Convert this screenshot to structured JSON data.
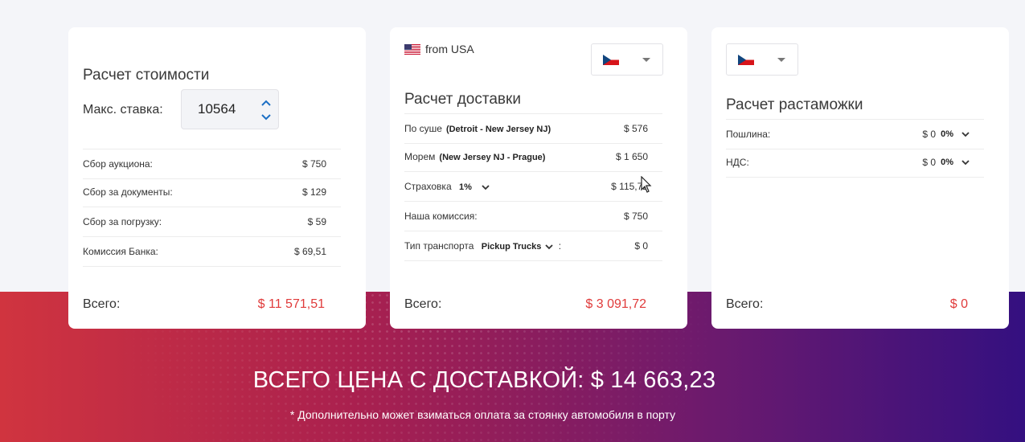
{
  "cost": {
    "title": "Расчет стоимости",
    "bid_label": "Макс. ставка:",
    "bid_value": "10564",
    "rows": [
      {
        "label": "Сбор аукциона:",
        "value": "$ 750"
      },
      {
        "label": "Сбор за документы:",
        "value": "$ 129"
      },
      {
        "label": "Сбор за погрузку:",
        "value": "$ 59"
      },
      {
        "label": "Комиссия Банка:",
        "value": "$ 69,51"
      }
    ],
    "total_label": "Всего:",
    "total_value": "$ 11 571,51"
  },
  "delivery": {
    "from_label": "from USA",
    "title": "Расчет доставки",
    "land_label": "По суше",
    "land_route": "(Detroit - New Jersey NJ)",
    "land_value": "$ 576",
    "sea_label": "Морем",
    "sea_route": "(New Jersey NJ - Prague)",
    "sea_value": "$ 1 650",
    "insurance_label": "Страховка",
    "insurance_option": "1%",
    "insurance_value": "$ 115,72",
    "commission_label": "Наша комиссия:",
    "commission_value": "$ 750",
    "transport_label": "Тип транспорта",
    "transport_option": "Pickup Trucks",
    "transport_suffix": ":",
    "transport_value": "$ 0",
    "total_label": "Всего:",
    "total_value": "$ 3 091,72"
  },
  "customs": {
    "title": "Расчет растаможки",
    "duty_label": "Пошлина:",
    "duty_value": "$ 0",
    "duty_pct": "0%",
    "vat_label": "НДС:",
    "vat_value": "$ 0",
    "vat_pct": "0%",
    "total_label": "Всего:",
    "total_value": "$ 0"
  },
  "summary": {
    "grand_total": "ВСЕГО ЦЕНА С ДОСТАВКОЙ: $ 14 663,23",
    "footnote": "* Дополнительно может взиматься оплата за стоянку автомобиля в порту"
  },
  "icons": {
    "us_flag": "us-flag-icon",
    "cz_flag": "czech-flag-icon",
    "chevron": "chevron-down-icon",
    "stepper": "stepper-arrows-icon"
  },
  "colors": {
    "total_red": "#e03a3a",
    "banner_left": "#d0343f",
    "banner_right": "#341080",
    "card_bg": "#ffffff"
  }
}
